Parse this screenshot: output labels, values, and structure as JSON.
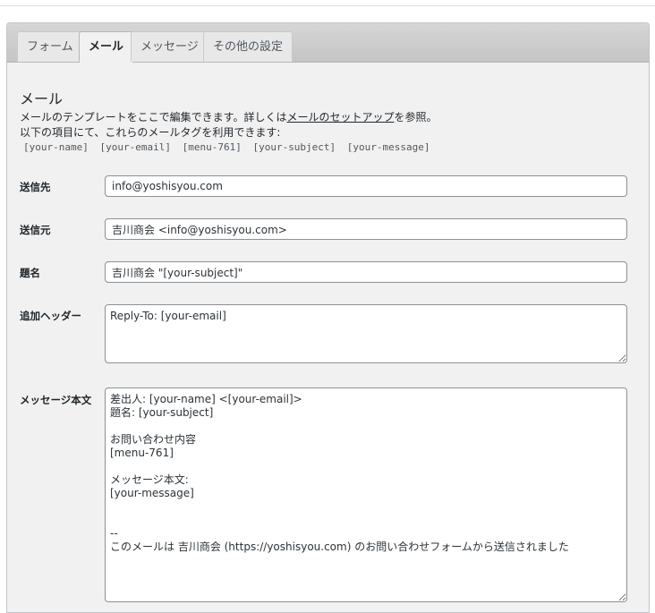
{
  "tabs": [
    {
      "label": "フォーム"
    },
    {
      "label": "メール"
    },
    {
      "label": "メッセージ"
    },
    {
      "label": "その他の設定"
    }
  ],
  "mail": {
    "title": "メール",
    "description_pre": "メールのテンプレートをここで編集できます。詳しくは",
    "description_link": "メールのセットアップ",
    "description_post": "を参照。",
    "description_line2": "以下の項目にて、これらのメールタグを利用できます:",
    "tags": [
      "[your-name]",
      "[your-email]",
      "[menu-761]",
      "[your-subject]",
      "[your-message]"
    ],
    "fields": {
      "to": {
        "label": "送信先",
        "value": "info@yoshisyou.com"
      },
      "from": {
        "label": "送信元",
        "value": "吉川商会 <info@yoshisyou.com>"
      },
      "subject": {
        "label": "題名",
        "value": "吉川商会 \"[your-subject]\""
      },
      "headers": {
        "label": "追加ヘッダー",
        "value": "Reply-To: [your-email]"
      },
      "body": {
        "label": "メッセージ本文",
        "value": "差出人: [your-name] <[your-email]>\n題名: [your-subject]\n\nお問い合わせ内容\n[menu-761]\n\nメッセージ本文:\n[your-message]\n\n\n--\nこのメールは 吉川商会 (https://yoshisyou.com) のお問い合わせフォームから送信されました"
      }
    }
  }
}
